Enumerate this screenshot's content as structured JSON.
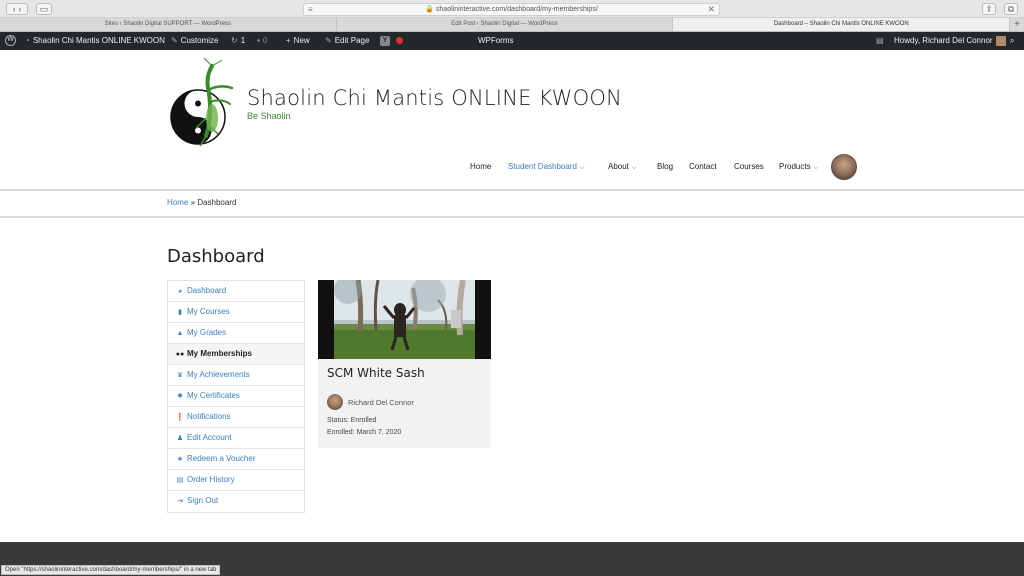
{
  "browser": {
    "url": "shaolininteractive.com/dashboard/my-memberships/",
    "tabs": [
      {
        "label": "Sites ‹ Shaolin Digital SUPPORT — WordPress",
        "active": false
      },
      {
        "label": "Edit Post ‹ Shaolin Digital — WordPress",
        "active": false
      },
      {
        "label": "Dashboard – Shaolin Chi Mantis ONLINE KWOON",
        "active": true
      }
    ],
    "status_tip": "Open \"https://shaolininteractive.com/dashboard/my-memberships/\" in a new tab"
  },
  "adminbar": {
    "site_name": "Shaolin Chi Mantis ONLINE KWOON",
    "customize": "Customize",
    "updates_count": "1",
    "comments_count": "0",
    "new_label": "New",
    "edit_page": "Edit Page",
    "wpforms": "WPForms",
    "howdy": "Howdy, Richard Del Connor"
  },
  "site": {
    "title": "Shaolin Chi Mantis ONLINE KWOON",
    "tagline": "Be Shaolin"
  },
  "nav": {
    "items": [
      {
        "label": "Home"
      },
      {
        "label": "Student Dashboard"
      },
      {
        "label": "About"
      },
      {
        "label": "Blog"
      },
      {
        "label": "Contact"
      },
      {
        "label": "Courses"
      },
      {
        "label": "Products"
      }
    ]
  },
  "breadcrumb": {
    "home": "Home",
    "separator": "»",
    "current": "Dashboard"
  },
  "page": {
    "title": "Dashboard"
  },
  "dashboard_menu": {
    "items": [
      {
        "label": "Dashboard",
        "icon": "dashboard-icon"
      },
      {
        "label": "My Courses",
        "icon": "book-icon"
      },
      {
        "label": "My Grades",
        "icon": "graduation-cap-icon"
      },
      {
        "label": "My Memberships",
        "icon": "users-icon"
      },
      {
        "label": "My Achievements",
        "icon": "trophy-icon"
      },
      {
        "label": "My Certificates",
        "icon": "certificate-icon"
      },
      {
        "label": "Notifications",
        "icon": "exclamation-icon"
      },
      {
        "label": "Edit Account",
        "icon": "user-icon"
      },
      {
        "label": "Redeem a Voucher",
        "icon": "star-icon"
      },
      {
        "label": "Order History",
        "icon": "list-icon"
      },
      {
        "label": "Sign Out",
        "icon": "sign-out-icon"
      }
    ]
  },
  "membership_card": {
    "title": "SCM White Sash",
    "author": "Richard Del Connor",
    "status": "Status: Enrolled",
    "enrolled": "Enrolled: March 7, 2020"
  },
  "colors": {
    "link": "#3a7fc1",
    "tagline_green": "#3a8a2a",
    "adminbar": "#23282d",
    "footer": "#3a3a3a"
  }
}
